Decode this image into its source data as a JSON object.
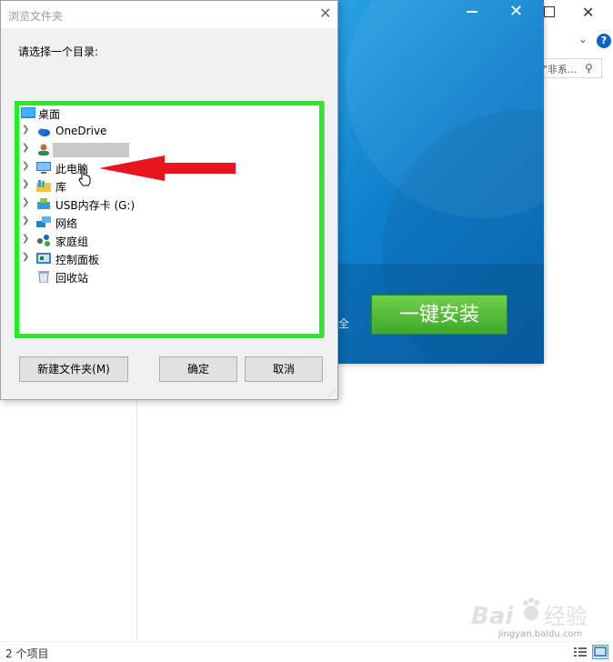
{
  "explorer": {
    "status_count": "2 个项目",
    "search_placeholder": "\"非系...",
    "help_glyph": "?",
    "close_glyph": "✕",
    "chevron_glyph": "⌄"
  },
  "installer": {
    "install_label": "一键安装",
    "footer_text": "全",
    "close_glyph": "✕"
  },
  "dialog": {
    "title": "浏览文件夹",
    "close_glyph": "✕",
    "prompt": "请选择一个目录:",
    "tree": [
      {
        "label": "桌面",
        "icon": "desktop-icon",
        "chevron": false
      },
      {
        "label": "OneDrive",
        "icon": "onedrive-cloud-icon",
        "chevron": true
      },
      {
        "label": "",
        "icon": "user-icon",
        "chevron": true
      },
      {
        "label": "此电脑",
        "icon": "computer-icon",
        "chevron": true
      },
      {
        "label": "库",
        "icon": "library-icon",
        "chevron": true
      },
      {
        "label": "USB内存卡 (G:)",
        "icon": "usb-drive-icon",
        "chevron": true
      },
      {
        "label": "网络",
        "icon": "network-icon",
        "chevron": true
      },
      {
        "label": "家庭组",
        "icon": "homegroup-icon",
        "chevron": true
      },
      {
        "label": "控制面板",
        "icon": "control-panel-icon",
        "chevron": true
      },
      {
        "label": "回收站",
        "icon": "recycle-bin-icon",
        "chevron": false
      }
    ],
    "buttons": {
      "new_folder": "新建文件夹(M)",
      "ok": "确定",
      "cancel": "取消"
    }
  },
  "colors": {
    "highlight": "#1ff01f",
    "arrow": "#e8141e",
    "install_green": "#4cb830",
    "installer_blue": "#1a8ad6"
  },
  "watermark": {
    "text": "Bai 经验",
    "sub": "jingyan.baidu.com"
  }
}
